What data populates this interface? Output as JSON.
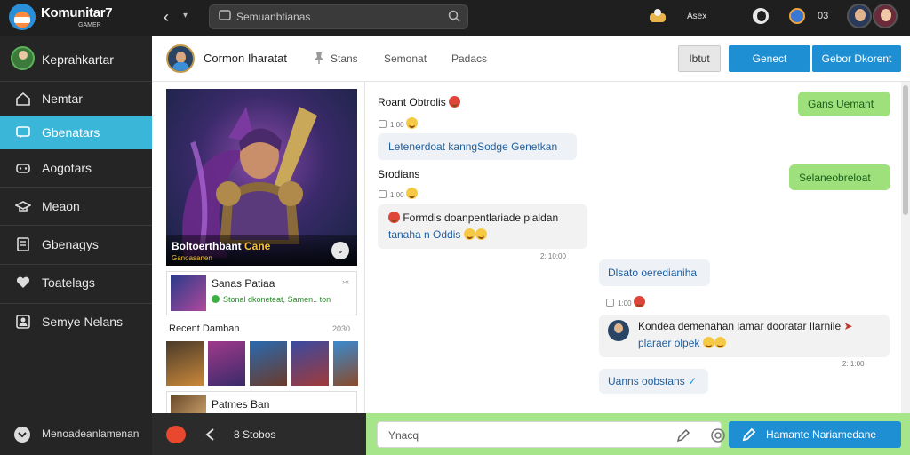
{
  "topbar": {
    "brand": "Komunitar7",
    "brand_sub": "GAMER",
    "search_placeholder": "Semuanbtianas",
    "label": "Asex",
    "count": "03",
    "icons": [
      "back-icon",
      "chevron-down-icon",
      "search-icon",
      "game-controller-icon",
      "moon-icon",
      "shield-icon"
    ]
  },
  "sidebar": {
    "profile_label": "Keprahkartar",
    "items": [
      {
        "label": "Nemtar",
        "icon": "home-icon",
        "active": false
      },
      {
        "label": "Gbenatars",
        "icon": "chat-icon",
        "active": true
      },
      {
        "label": "Aogotars",
        "icon": "controller-icon",
        "active": false
      },
      {
        "label": "Meaon",
        "icon": "hat-icon",
        "active": false
      },
      {
        "label": "Gbenagys",
        "icon": "list-icon",
        "active": false
      },
      {
        "label": "Toatelags",
        "icon": "heart-icon",
        "active": false
      },
      {
        "label": "Semye Nelans",
        "icon": "user-icon",
        "active": false
      }
    ],
    "bottom_label": "Menoadeanlamenan",
    "accent": "#3ab6d9"
  },
  "chat_header": {
    "title": "Cormon Iharatat",
    "tabs": [
      "Stans",
      "Semonat",
      "Padacs"
    ],
    "grey_button": "Ibtut",
    "blue_buttons": [
      "Genect",
      "Gebor Dkorent"
    ],
    "accent": "#1e8fd3"
  },
  "left_panel": {
    "hero_title": "Boltoerthbant",
    "hero_title_accent": "Cane",
    "hero_sub": "Ganoasanen",
    "card1": {
      "title": "Sanas Patiaa",
      "status": "Stonal dkoneteat,",
      "status2": "Samen.. ton",
      "side": "›«"
    },
    "section_label": "Recent Damban",
    "section_count": "2030",
    "card2": {
      "title": "Patmes Ban"
    }
  },
  "messages": [
    {
      "sender": "Roant Obtrolis",
      "meta": "1:00",
      "bubble": "Letenerdoat kanngSodge Genetkan",
      "side": "left",
      "style": "blue"
    },
    {
      "sender": "Srodians",
      "meta": "1:00",
      "bubble_lines": [
        "Formdis doanpentlariade pialdan",
        "tanaha n Oddis"
      ],
      "side": "left",
      "style": "plain",
      "time": "2: 10:00"
    },
    {
      "bubble": "Dlsato oeredianiha",
      "side": "right",
      "style": "blue"
    },
    {
      "meta": "1:00",
      "bubble_lines": [
        "Kondea demenahan lamar dooratar Ilarnile",
        "plaraer olpek"
      ],
      "side": "right",
      "style": "plain",
      "time": "2: 1:00"
    },
    {
      "bubble": "Uanns oobstans",
      "side": "right",
      "style": "blue"
    },
    {
      "bubble": "Gans Uemant",
      "side": "right",
      "style": "green"
    },
    {
      "bubble": "Selaneobreloat",
      "side": "right",
      "style": "green"
    }
  ],
  "bottom": {
    "left_text": "8 Stobos",
    "placeholder": "Ynacq",
    "send_label": "Hamante Nariamedane",
    "composer_color": "#a6e58a"
  }
}
